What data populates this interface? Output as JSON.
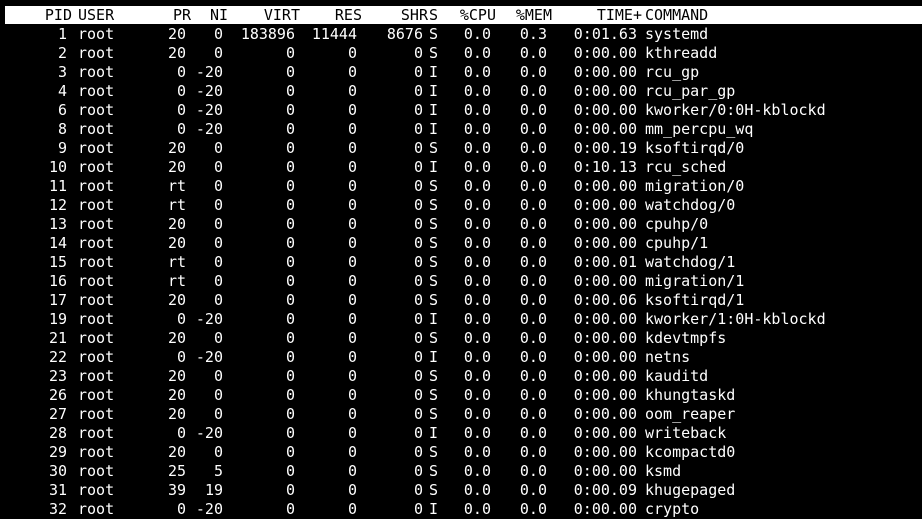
{
  "colors": {
    "background": "#000000",
    "text": "#ffffff",
    "header_background": "#ffffff",
    "header_text": "#000000"
  },
  "header": {
    "pid": "PID",
    "user": "USER",
    "pr": "PR",
    "ni": "NI",
    "virt": "VIRT",
    "res": "RES",
    "shr": "SHR",
    "s": "S",
    "cpu": "%CPU",
    "mem": "%MEM",
    "time": "TIME+",
    "command": "COMMAND"
  },
  "processes": [
    {
      "pid": "1",
      "user": "root",
      "pr": "20",
      "ni": "0",
      "virt": "183896",
      "res": "11444",
      "shr": "8676",
      "s": "S",
      "cpu": "0.0",
      "mem": "0.3",
      "time": "0:01.63",
      "command": "systemd"
    },
    {
      "pid": "2",
      "user": "root",
      "pr": "20",
      "ni": "0",
      "virt": "0",
      "res": "0",
      "shr": "0",
      "s": "S",
      "cpu": "0.0",
      "mem": "0.0",
      "time": "0:00.00",
      "command": "kthreadd"
    },
    {
      "pid": "3",
      "user": "root",
      "pr": "0",
      "ni": "-20",
      "virt": "0",
      "res": "0",
      "shr": "0",
      "s": "I",
      "cpu": "0.0",
      "mem": "0.0",
      "time": "0:00.00",
      "command": "rcu_gp"
    },
    {
      "pid": "4",
      "user": "root",
      "pr": "0",
      "ni": "-20",
      "virt": "0",
      "res": "0",
      "shr": "0",
      "s": "I",
      "cpu": "0.0",
      "mem": "0.0",
      "time": "0:00.00",
      "command": "rcu_par_gp"
    },
    {
      "pid": "6",
      "user": "root",
      "pr": "0",
      "ni": "-20",
      "virt": "0",
      "res": "0",
      "shr": "0",
      "s": "I",
      "cpu": "0.0",
      "mem": "0.0",
      "time": "0:00.00",
      "command": "kworker/0:0H-kblockd"
    },
    {
      "pid": "8",
      "user": "root",
      "pr": "0",
      "ni": "-20",
      "virt": "0",
      "res": "0",
      "shr": "0",
      "s": "I",
      "cpu": "0.0",
      "mem": "0.0",
      "time": "0:00.00",
      "command": "mm_percpu_wq"
    },
    {
      "pid": "9",
      "user": "root",
      "pr": "20",
      "ni": "0",
      "virt": "0",
      "res": "0",
      "shr": "0",
      "s": "S",
      "cpu": "0.0",
      "mem": "0.0",
      "time": "0:00.19",
      "command": "ksoftirqd/0"
    },
    {
      "pid": "10",
      "user": "root",
      "pr": "20",
      "ni": "0",
      "virt": "0",
      "res": "0",
      "shr": "0",
      "s": "I",
      "cpu": "0.0",
      "mem": "0.0",
      "time": "0:10.13",
      "command": "rcu_sched"
    },
    {
      "pid": "11",
      "user": "root",
      "pr": "rt",
      "ni": "0",
      "virt": "0",
      "res": "0",
      "shr": "0",
      "s": "S",
      "cpu": "0.0",
      "mem": "0.0",
      "time": "0:00.00",
      "command": "migration/0"
    },
    {
      "pid": "12",
      "user": "root",
      "pr": "rt",
      "ni": "0",
      "virt": "0",
      "res": "0",
      "shr": "0",
      "s": "S",
      "cpu": "0.0",
      "mem": "0.0",
      "time": "0:00.00",
      "command": "watchdog/0"
    },
    {
      "pid": "13",
      "user": "root",
      "pr": "20",
      "ni": "0",
      "virt": "0",
      "res": "0",
      "shr": "0",
      "s": "S",
      "cpu": "0.0",
      "mem": "0.0",
      "time": "0:00.00",
      "command": "cpuhp/0"
    },
    {
      "pid": "14",
      "user": "root",
      "pr": "20",
      "ni": "0",
      "virt": "0",
      "res": "0",
      "shr": "0",
      "s": "S",
      "cpu": "0.0",
      "mem": "0.0",
      "time": "0:00.00",
      "command": "cpuhp/1"
    },
    {
      "pid": "15",
      "user": "root",
      "pr": "rt",
      "ni": "0",
      "virt": "0",
      "res": "0",
      "shr": "0",
      "s": "S",
      "cpu": "0.0",
      "mem": "0.0",
      "time": "0:00.01",
      "command": "watchdog/1"
    },
    {
      "pid": "16",
      "user": "root",
      "pr": "rt",
      "ni": "0",
      "virt": "0",
      "res": "0",
      "shr": "0",
      "s": "S",
      "cpu": "0.0",
      "mem": "0.0",
      "time": "0:00.00",
      "command": "migration/1"
    },
    {
      "pid": "17",
      "user": "root",
      "pr": "20",
      "ni": "0",
      "virt": "0",
      "res": "0",
      "shr": "0",
      "s": "S",
      "cpu": "0.0",
      "mem": "0.0",
      "time": "0:00.06",
      "command": "ksoftirqd/1"
    },
    {
      "pid": "19",
      "user": "root",
      "pr": "0",
      "ni": "-20",
      "virt": "0",
      "res": "0",
      "shr": "0",
      "s": "I",
      "cpu": "0.0",
      "mem": "0.0",
      "time": "0:00.00",
      "command": "kworker/1:0H-kblockd"
    },
    {
      "pid": "21",
      "user": "root",
      "pr": "20",
      "ni": "0",
      "virt": "0",
      "res": "0",
      "shr": "0",
      "s": "S",
      "cpu": "0.0",
      "mem": "0.0",
      "time": "0:00.00",
      "command": "kdevtmpfs"
    },
    {
      "pid": "22",
      "user": "root",
      "pr": "0",
      "ni": "-20",
      "virt": "0",
      "res": "0",
      "shr": "0",
      "s": "I",
      "cpu": "0.0",
      "mem": "0.0",
      "time": "0:00.00",
      "command": "netns"
    },
    {
      "pid": "23",
      "user": "root",
      "pr": "20",
      "ni": "0",
      "virt": "0",
      "res": "0",
      "shr": "0",
      "s": "S",
      "cpu": "0.0",
      "mem": "0.0",
      "time": "0:00.00",
      "command": "kauditd"
    },
    {
      "pid": "26",
      "user": "root",
      "pr": "20",
      "ni": "0",
      "virt": "0",
      "res": "0",
      "shr": "0",
      "s": "S",
      "cpu": "0.0",
      "mem": "0.0",
      "time": "0:00.00",
      "command": "khungtaskd"
    },
    {
      "pid": "27",
      "user": "root",
      "pr": "20",
      "ni": "0",
      "virt": "0",
      "res": "0",
      "shr": "0",
      "s": "S",
      "cpu": "0.0",
      "mem": "0.0",
      "time": "0:00.00",
      "command": "oom_reaper"
    },
    {
      "pid": "28",
      "user": "root",
      "pr": "0",
      "ni": "-20",
      "virt": "0",
      "res": "0",
      "shr": "0",
      "s": "I",
      "cpu": "0.0",
      "mem": "0.0",
      "time": "0:00.00",
      "command": "writeback"
    },
    {
      "pid": "29",
      "user": "root",
      "pr": "20",
      "ni": "0",
      "virt": "0",
      "res": "0",
      "shr": "0",
      "s": "S",
      "cpu": "0.0",
      "mem": "0.0",
      "time": "0:00.00",
      "command": "kcompactd0"
    },
    {
      "pid": "30",
      "user": "root",
      "pr": "25",
      "ni": "5",
      "virt": "0",
      "res": "0",
      "shr": "0",
      "s": "S",
      "cpu": "0.0",
      "mem": "0.0",
      "time": "0:00.00",
      "command": "ksmd"
    },
    {
      "pid": "31",
      "user": "root",
      "pr": "39",
      "ni": "19",
      "virt": "0",
      "res": "0",
      "shr": "0",
      "s": "S",
      "cpu": "0.0",
      "mem": "0.0",
      "time": "0:00.09",
      "command": "khugepaged"
    },
    {
      "pid": "32",
      "user": "root",
      "pr": "0",
      "ni": "-20",
      "virt": "0",
      "res": "0",
      "shr": "0",
      "s": "I",
      "cpu": "0.0",
      "mem": "0.0",
      "time": "0:00.00",
      "command": "crypto"
    }
  ]
}
